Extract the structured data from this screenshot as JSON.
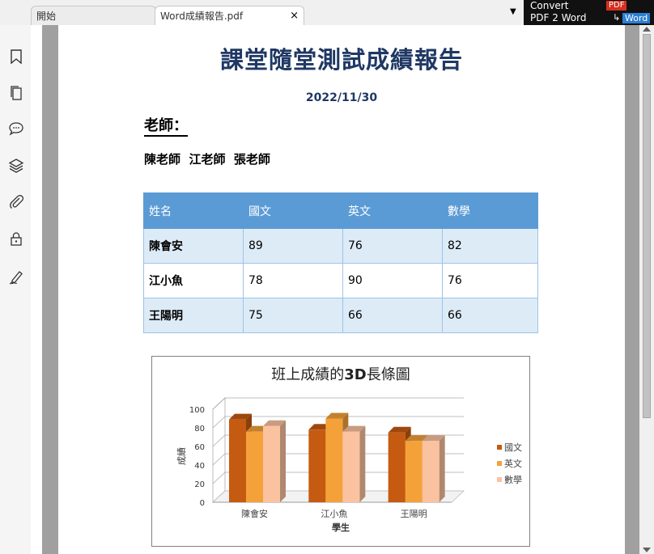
{
  "tabs": [
    {
      "label": "開始"
    },
    {
      "label": "Word成績報告.pdf",
      "close": "×"
    }
  ],
  "tab_menu": "▼",
  "banner": {
    "line1": "Convert",
    "line2": "PDF 2 Word",
    "pdf_badge": "PDF",
    "arrow": "↳",
    "word_badge": "Word"
  },
  "sidebar": {
    "icons": [
      "bookmark-icon",
      "pages-icon",
      "comment-icon",
      "layers-icon",
      "attachment-icon",
      "lock-icon",
      "signature-icon"
    ]
  },
  "document": {
    "title": "課堂隨堂測試成績報告",
    "date": "2022/11/30",
    "teacher_label": "老師：",
    "teacher_names": "陳老師  江老師  張老師",
    "table": {
      "headers": [
        "姓名",
        "國文",
        "英文",
        "數學"
      ],
      "rows": [
        [
          "陳會安",
          "89",
          "76",
          "82"
        ],
        [
          "江小魚",
          "78",
          "90",
          "76"
        ],
        [
          "王陽明",
          "75",
          "66",
          "66"
        ]
      ]
    }
  },
  "chart_data": {
    "type": "bar",
    "title_prefix": "班上成績的",
    "title_bold": "3D",
    "title_suffix": "長條圖",
    "categories": [
      "陳會安",
      "江小魚",
      "王陽明"
    ],
    "series": [
      {
        "name": "國文",
        "values": [
          89,
          78,
          75
        ],
        "color": "#c55a11"
      },
      {
        "name": "英文",
        "values": [
          76,
          90,
          66
        ],
        "color": "#f4a13a"
      },
      {
        "name": "數學",
        "values": [
          82,
          76,
          66
        ],
        "color": "#fbc2a0"
      }
    ],
    "xlabel": "學生",
    "ylabel": "成績",
    "ylim": [
      0,
      100
    ],
    "yticks": [
      "0",
      "20",
      "40",
      "60",
      "80",
      "100"
    ],
    "grid": true,
    "legend": "right"
  }
}
